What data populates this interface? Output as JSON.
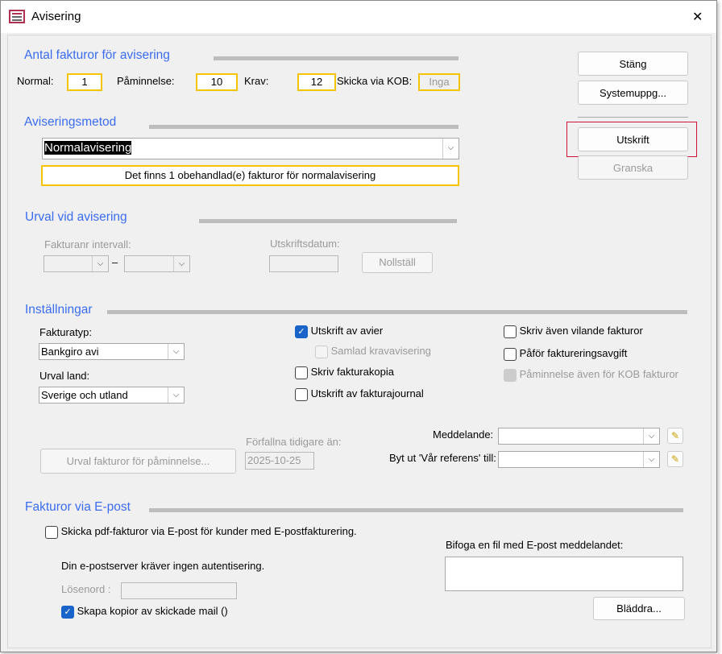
{
  "window": {
    "title": "Avisering",
    "close": "✕"
  },
  "antal": {
    "heading": "Antal fakturor för avisering",
    "normal_label": "Normal:",
    "normal": "1",
    "paminnelse_label": "Påminnelse:",
    "paminnelse": "10",
    "krav_label": "Krav:",
    "krav": "12",
    "kob_label": "Skicka via KOB:",
    "kob": "Inga"
  },
  "metod": {
    "heading": "Aviseringsmetod",
    "selected": "Normalavisering",
    "info": "Det finns 1 obehandlad(e) fakturor för normalavisering"
  },
  "urval": {
    "heading": "Urval vid avisering",
    "intervall_label": "Fakturanr intervall:",
    "dash": "–",
    "datum_label": "Utskriftsdatum:",
    "nollstall": "Nollställ"
  },
  "buttons": {
    "stang": "Stäng",
    "systemuppg": "Systemuppg...",
    "utskrift": "Utskrift",
    "granska": "Granska"
  },
  "installningar": {
    "heading": "Inställningar",
    "fakturatyp_label": "Fakturatyp:",
    "fakturatyp": "Bankgiro avi",
    "urval_land_label": "Urval land:",
    "urval_land": "Sverige och utland",
    "cb_utskrift_avier": "Utskrift av avier",
    "cb_samlad": "Samlad kravavisering",
    "cb_fakturakopia": "Skriv fakturakopia",
    "cb_journal": "Utskrift av fakturajournal",
    "cb_vilande": "Skriv även vilande fakturor",
    "cb_avgift": "Påför faktureringsavgift",
    "cb_kob": "Påminnelse även för KOB fakturor",
    "urval_paminnelse": "Urval fakturor för påminnelse...",
    "forfallna_label": "Förfallna tidigare än:",
    "forfallna": "2025-10-25",
    "meddelande_label": "Meddelande:",
    "referens_label": "Byt ut 'Vår referens' till:"
  },
  "epost": {
    "heading": "Fakturor via E-post",
    "cb_skicka": "Skicka pdf-fakturor via E-post för kunder med E-postfakturering.",
    "auth": "Din e-postserver kräver ingen autentisering.",
    "losenord_label": "Lösenord :",
    "cb_kopior": "Skapa kopior av skickade mail ()",
    "bifoga_label": "Bifoga en fil med E-post meddelandet:",
    "bladdra": "Bläddra..."
  },
  "colors": {
    "accent": "#3b6cf0",
    "highlight": "#f5c400",
    "focus": "#d0103a"
  }
}
